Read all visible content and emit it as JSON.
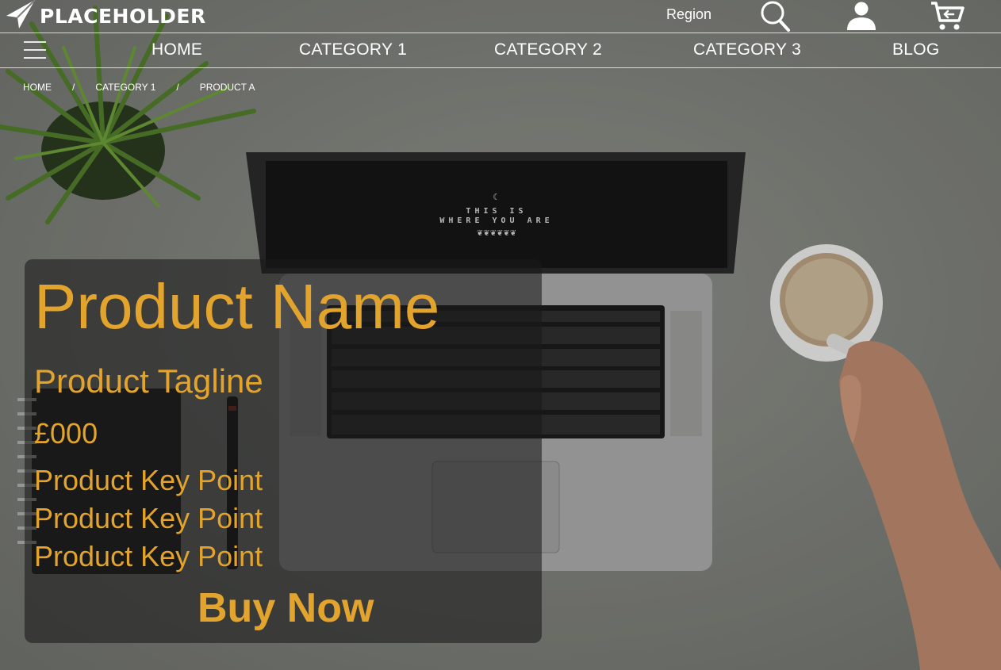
{
  "brand": {
    "name": "PLACEHOLDER",
    "icon": "logo-arrow-icon"
  },
  "header": {
    "region_label": "Region",
    "icons": [
      "search-icon",
      "user-icon",
      "cart-icon"
    ]
  },
  "nav": {
    "items": [
      "HOME",
      "CATEGORY 1",
      "CATEGORY 2",
      "CATEGORY 3",
      "BLOG"
    ],
    "menu_icon": "hamburger-menu-icon"
  },
  "breadcrumb": {
    "items": [
      "HOME",
      "CATEGORY 1",
      "PRODUCT A"
    ],
    "separator": "/"
  },
  "screen_text": {
    "line1": "THIS IS",
    "line2": "WHERE YOU ARE"
  },
  "product": {
    "name": "Product Name",
    "tagline": "Product Tagline",
    "price": "£000",
    "key_points": [
      "Product Key Point",
      "Product Key Point",
      "Product Key Point"
    ],
    "buy_label": "Buy Now"
  },
  "colors": {
    "accent": "#e3a42d",
    "background": "#7d7f79",
    "card": "rgba(25,25,25,0.58)"
  }
}
